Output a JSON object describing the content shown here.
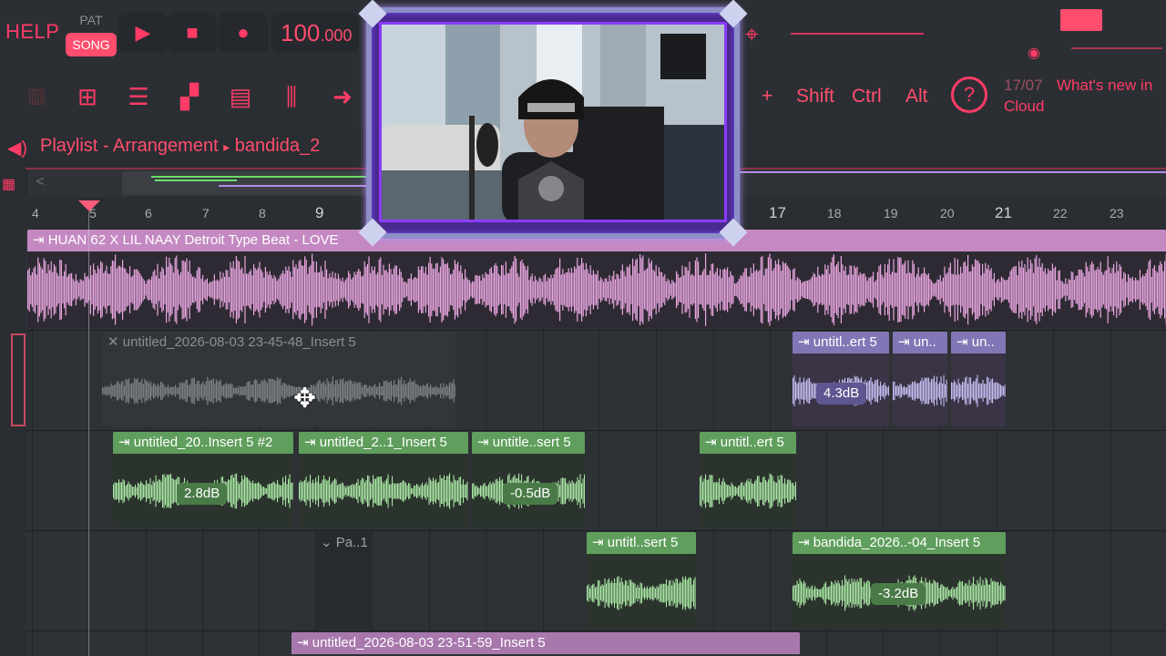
{
  "topbar": {
    "help": "HELP",
    "pat": "PAT",
    "song": "SONG",
    "play_icon": "play-icon",
    "stop_icon": "stop-icon",
    "record_icon": "record-icon",
    "tempo_main": "100",
    "tempo_frac": ".000"
  },
  "toolbar": {
    "keys": [
      "Shift",
      "Ctrl",
      "Alt"
    ],
    "plus": "+",
    "news_date": "17/07",
    "news_text": "What's new in",
    "news_text2": "Cloud"
  },
  "playlist": {
    "title": "Playlist - Arrangement",
    "separator": "▸",
    "pattern": "bandida_2",
    "scroll_left": "<"
  },
  "ruler": {
    "bars": [
      "4",
      "5",
      "6",
      "7",
      "8",
      "9",
      "17",
      "18",
      "19",
      "20",
      "21",
      "22",
      "23"
    ]
  },
  "clips": {
    "master_audio": "HUAN 62 X LIL NAAY Detroit Type Beat - LOVE",
    "grey_clip": "untitled_2026-08-03 23-45-48_Insert 5",
    "lav1": "untitl..ert 5",
    "lav2": "un..",
    "lav3": "un..",
    "lav_gain": "4.3dB",
    "g1": "untitled_20..Insert 5 #2",
    "g1_gain": "2.8dB",
    "g2": "untitled_2..1_Insert 5",
    "g3": "untitle..sert 5",
    "g3_gain": "-0.5dB",
    "g4": "untitl..ert 5",
    "pattern_clip": "Pa..1",
    "g5": "untitl..sert 5",
    "g6": "bandida_2026..-04_Insert 5",
    "g6_gain": "-3.2dB",
    "bottom": "untitled_2026-08-03 23-51-59_Insert 5"
  },
  "colors": {
    "accent": "#ff3b66",
    "green_clip": "#5f9e5c",
    "green_wave": "#a8e6a3",
    "pink_wave": "#e8a6e0",
    "lav_wave": "#c4bdf0",
    "grey_wave": "#7d8085"
  }
}
